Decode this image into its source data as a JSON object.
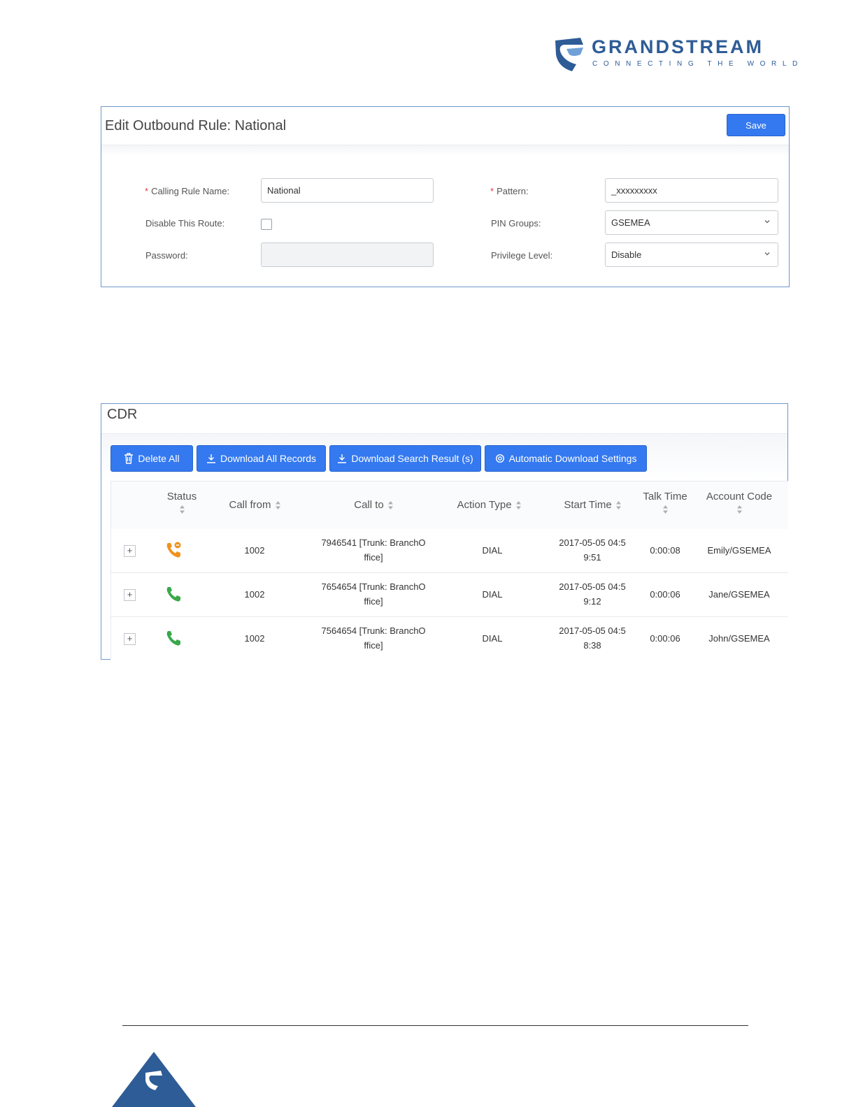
{
  "brand": {
    "name": "GRANDSTREAM",
    "tagline": "CONNECTING THE WORLD",
    "color": "#2e5c96"
  },
  "outbound_rule": {
    "title": "Edit Outbound Rule: National",
    "save_label": "Save",
    "fields": {
      "calling_rule_name_label": "Calling Rule Name:",
      "calling_rule_name_value": "National",
      "disable_route_label": "Disable This Route:",
      "disable_route_checked": false,
      "password_label": "Password:",
      "password_value": "",
      "pattern_label": "Pattern:",
      "pattern_value": "_xxxxxxxxx",
      "pin_groups_label": "PIN Groups:",
      "pin_groups_value": "GSEMEA",
      "privilege_label": "Privilege Level:",
      "privilege_value": "Disable"
    }
  },
  "cdr": {
    "title": "CDR",
    "buttons": {
      "delete_all": "Delete All",
      "download_all": "Download All Records",
      "download_search": "Download Search Result (s)",
      "auto_download": "Automatic Download Settings"
    },
    "columns": {
      "status": "Status",
      "call_from": "Call from",
      "call_to": "Call to",
      "action_type": "Action Type",
      "start_time": "Start Time",
      "talk_time": "Talk Time",
      "account_code": "Account Code"
    },
    "rows": [
      {
        "status_icon": "phone-missed-icon",
        "call_from": "1002",
        "call_to_1": "7946541 [Trunk: BranchO",
        "call_to_2": "ffice]",
        "action_type": "DIAL",
        "start_time_1": "2017-05-05 04:5",
        "start_time_2": "9:51",
        "talk_time": "0:00:08",
        "account_code": "Emily/GSEMEA"
      },
      {
        "status_icon": "phone-answered-icon",
        "call_from": "1002",
        "call_to_1": "7654654 [Trunk: BranchO",
        "call_to_2": "ffice]",
        "action_type": "DIAL",
        "start_time_1": "2017-05-05 04:5",
        "start_time_2": "9:12",
        "talk_time": "0:00:06",
        "account_code": "Jane/GSEMEA"
      },
      {
        "status_icon": "phone-answered-icon",
        "call_from": "1002",
        "call_to_1": "7564654 [Trunk: BranchO",
        "call_to_2": "ffice]",
        "action_type": "DIAL",
        "start_time_1": "2017-05-05 04:5",
        "start_time_2": "8:38",
        "talk_time": "0:00:06",
        "account_code": "John/GSEMEA"
      }
    ],
    "expand_symbol": "+"
  },
  "colors": {
    "primary_button": "#3479f0",
    "panel_border": "#6f97c9",
    "answered": "#3aa84a",
    "missed": "#f0921e",
    "required": "#e23c3c"
  }
}
